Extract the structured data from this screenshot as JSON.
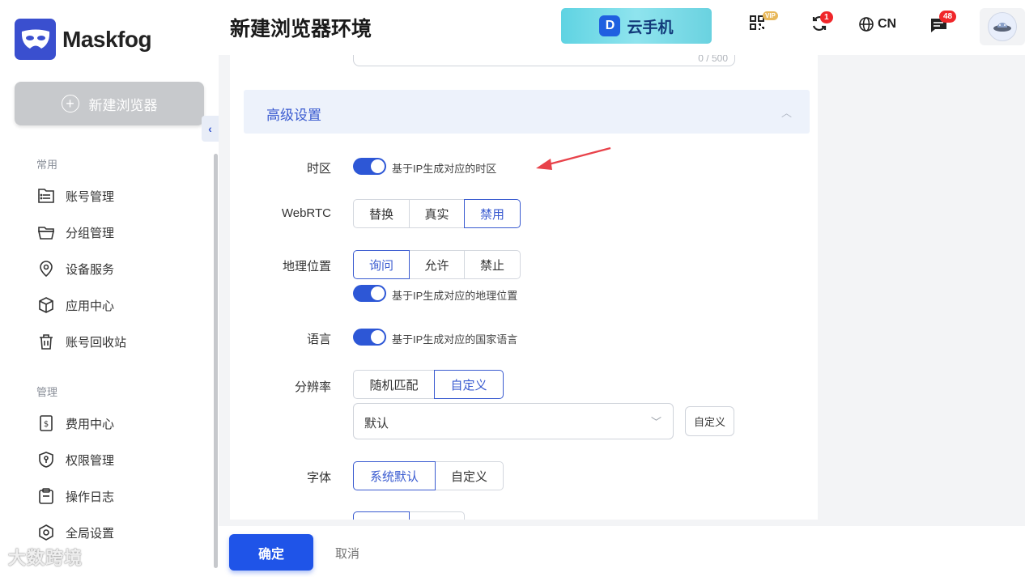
{
  "app": {
    "name": "Maskfog"
  },
  "sidebar": {
    "new_browser_label": "新建浏览器",
    "sections": [
      {
        "label": "常用",
        "items": [
          {
            "label": "账号管理",
            "icon": "account-list-icon"
          },
          {
            "label": "分组管理",
            "icon": "folder-icon"
          },
          {
            "label": "设备服务",
            "icon": "location-pin-icon"
          },
          {
            "label": "应用中心",
            "icon": "cube-icon"
          },
          {
            "label": "账号回收站",
            "icon": "trash-icon"
          }
        ]
      },
      {
        "label": "管理",
        "items": [
          {
            "label": "费用中心",
            "icon": "dollar-receipt-icon"
          },
          {
            "label": "权限管理",
            "icon": "shield-key-icon"
          },
          {
            "label": "操作日志",
            "icon": "clipboard-icon"
          },
          {
            "label": "全局设置",
            "icon": "settings-hex-icon"
          }
        ]
      }
    ]
  },
  "header": {
    "title": "新建浏览器环境",
    "banner_text": "云手机",
    "vip_label": "VIP",
    "sync_badge": "1",
    "language": "CN",
    "message_badge": "48"
  },
  "form": {
    "textarea_counter": "0 / 500",
    "advanced_title": "高级设置",
    "timezone": {
      "label": "时区",
      "toggle_text": "基于IP生成对应的时区",
      "enabled": true
    },
    "webrtc": {
      "label": "WebRTC",
      "options": [
        "替换",
        "真实",
        "禁用"
      ],
      "selected": "禁用"
    },
    "geolocation": {
      "label": "地理位置",
      "options": [
        "询问",
        "允许",
        "禁止"
      ],
      "selected": "询问",
      "toggle_text": "基于IP生成对应的地理位置",
      "enabled": true
    },
    "language": {
      "label": "语言",
      "toggle_text": "基于IP生成对应的国家语言",
      "enabled": true
    },
    "resolution": {
      "label": "分辨率",
      "options": [
        "随机匹配",
        "自定义"
      ],
      "selected": "自定义",
      "select_value": "默认",
      "custom_button": "自定义"
    },
    "font": {
      "label": "字体",
      "options": [
        "系统默认",
        "自定义"
      ],
      "selected": "系统默认"
    }
  },
  "footer": {
    "confirm_label": "确定",
    "cancel_label": "取消"
  },
  "watermark": "大数跨境",
  "colors": {
    "primary": "#1f54e8",
    "accent": "#3a5bd0",
    "annotation_arrow": "#e8424a"
  }
}
